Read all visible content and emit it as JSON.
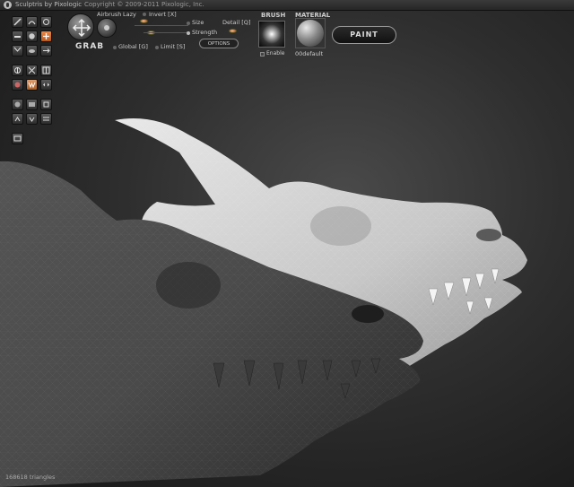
{
  "app": {
    "title": "Sculptris by Pixologic",
    "copyright": "Copyright © 2009-2011 Pixologic, Inc."
  },
  "tool": {
    "name": "GRAB",
    "airbrush_label": "Airbrush",
    "lazy_label": "Lazy",
    "invert_label": "Invert [X]",
    "size_label": "Size",
    "detail_label": "Detail [Q]",
    "strength_label": "Strength",
    "global_label": "Global [G]",
    "limit_label": "Limit [S]",
    "options_label": "OPTIONS"
  },
  "brush": {
    "heading": "BRUSH",
    "enable_label": "Enable"
  },
  "material": {
    "heading": "MATERIAL",
    "name": "00default"
  },
  "paint_label": "PAINT",
  "status": "168618 triangles",
  "colors": {
    "accent": "#d8763a",
    "background": "#2a2a2a",
    "mesh_light": "#d8d8d8",
    "mesh_dark": "#4a4a4a"
  },
  "toolbar_icons": [
    "draw-icon",
    "crease-icon",
    "rotate-icon",
    "scale-icon",
    "flatten-icon",
    "inflate-icon",
    "pinch-icon",
    "grab-icon",
    "smooth-icon",
    "mirror-icon",
    "wireframe-icon",
    "move-icon",
    "undo-icon",
    "reduce-icon",
    "mask-icon",
    "symmetry-icon",
    "sphere-icon",
    "plane-icon",
    "load-icon",
    "save-icon",
    "settings-icon"
  ]
}
